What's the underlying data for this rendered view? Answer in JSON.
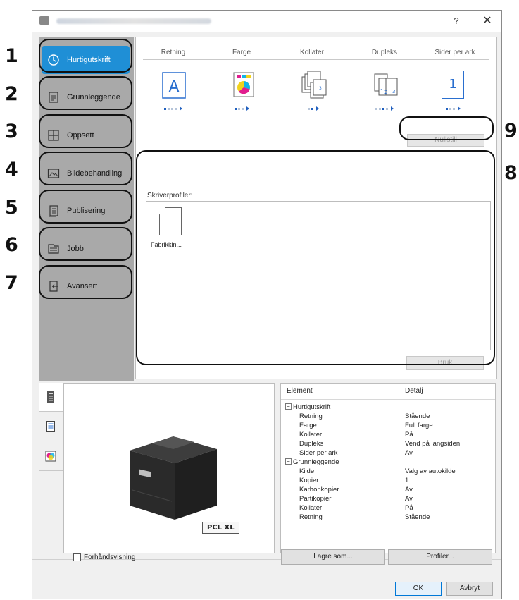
{
  "callouts": [
    "1",
    "2",
    "3",
    "4",
    "5",
    "6",
    "7",
    "8",
    "9"
  ],
  "sidebar": {
    "items": [
      {
        "label": "Hurtigutskrift",
        "icon": "clock-icon"
      },
      {
        "label": "Grunnleggende",
        "icon": "document-icon"
      },
      {
        "label": "Oppsett",
        "icon": "layout-grid-icon"
      },
      {
        "label": "Bildebehandling",
        "icon": "image-icon"
      },
      {
        "label": "Publisering",
        "icon": "pages-icon"
      },
      {
        "label": "Jobb",
        "icon": "job-stack-icon"
      },
      {
        "label": "Avansert",
        "icon": "advanced-icon"
      }
    ]
  },
  "quick": {
    "columns": [
      "Retning",
      "Farge",
      "Kollater",
      "Dupleks",
      "Sider per ark"
    ],
    "pages_per_sheet": "1",
    "reset_label": "Nullstill"
  },
  "profiles": {
    "label": "Skriverprofiler:",
    "item": "Fabrikkin...",
    "apply_label": "Bruk"
  },
  "preview": {
    "badge": "PCL XL",
    "checkbox_label": "Forhåndsvisning"
  },
  "summary": {
    "col_element": "Element",
    "col_detail": "Detalj",
    "rows": [
      {
        "group": true,
        "key": "Hurtigutskrift",
        "value": ""
      },
      {
        "key": "Retning",
        "value": "Stående"
      },
      {
        "key": "Farge",
        "value": "Full farge"
      },
      {
        "key": "Kollater",
        "value": "På"
      },
      {
        "key": "Dupleks",
        "value": "Vend på langsiden"
      },
      {
        "key": "Sider per ark",
        "value": "Av"
      },
      {
        "group": true,
        "key": "Grunnleggende",
        "value": ""
      },
      {
        "key": "Kilde",
        "value": "Valg av autokilde"
      },
      {
        "key": "Kopier",
        "value": "1"
      },
      {
        "key": "Karbonkopier",
        "value": "Av"
      },
      {
        "key": "Partikopier",
        "value": "Av"
      },
      {
        "key": "Kollater",
        "value": "På"
      },
      {
        "key": "Retning",
        "value": "Stående"
      }
    ]
  },
  "buttons": {
    "save_as": "Lagre som...",
    "profiles": "Profiler...",
    "ok": "OK",
    "cancel": "Avbryt"
  },
  "window": {
    "help": "?",
    "close": "✕"
  },
  "colors": {
    "accent": "#1f8fd6",
    "sidebar": "#a9a9a9"
  }
}
